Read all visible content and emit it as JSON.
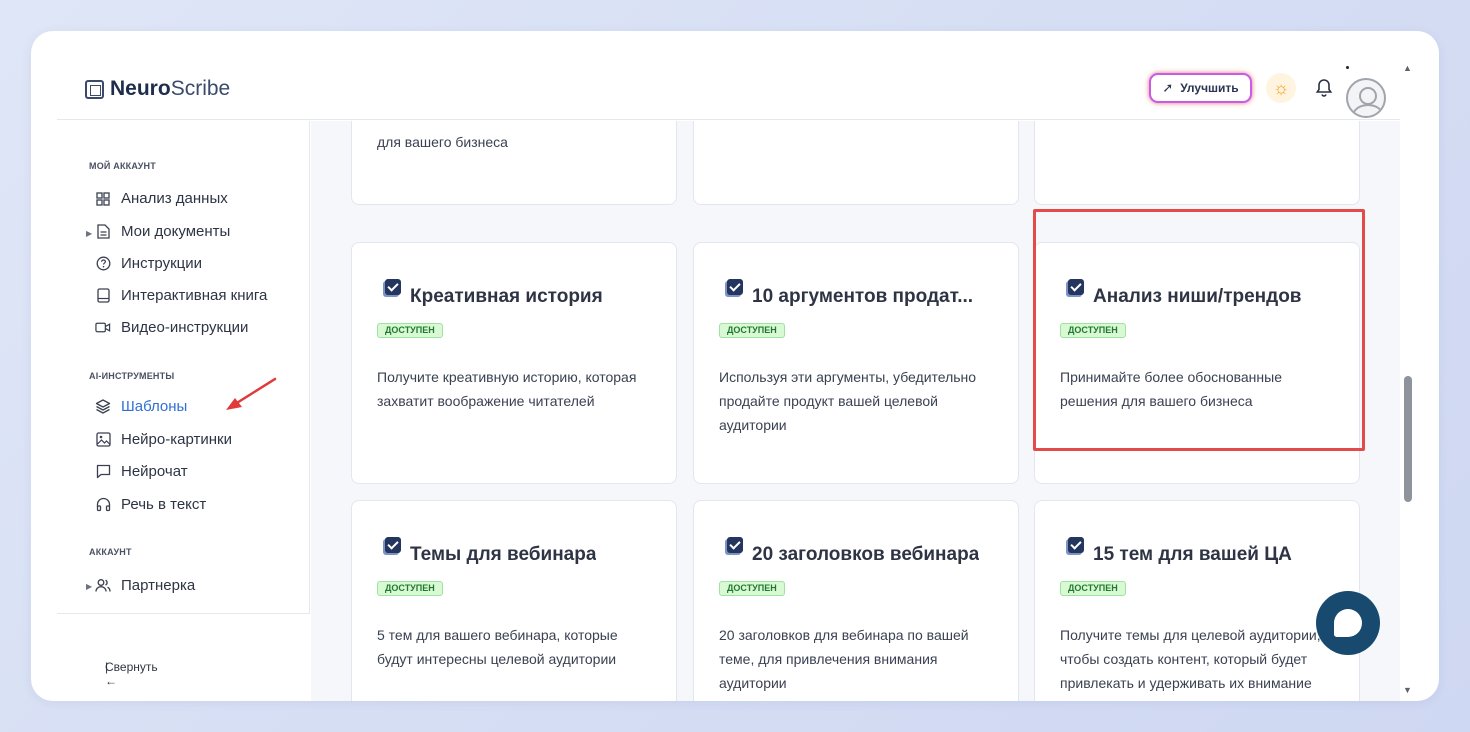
{
  "header": {
    "logo_bold": "Neuro",
    "logo_rest": "Scribe",
    "upgrade_label": "Улучшить"
  },
  "sidebar": {
    "section_account": "МОЙ АККАУНТ",
    "items_account": [
      {
        "label": "Анализ данных",
        "icon": "grid-icon"
      },
      {
        "label": "Мои документы",
        "icon": "document-icon"
      },
      {
        "label": "Инструкции",
        "icon": "help-icon"
      },
      {
        "label": "Интерактивная книга",
        "icon": "book-icon"
      },
      {
        "label": "Видео-инструкции",
        "icon": "video-icon"
      }
    ],
    "section_ai": "AI-ИНСТРУМЕНТЫ",
    "items_ai": [
      {
        "label": "Шаблоны",
        "icon": "layers-icon"
      },
      {
        "label": "Нейро-картинки",
        "icon": "image-icon"
      },
      {
        "label": "Нейрочат",
        "icon": "chat-icon"
      },
      {
        "label": "Речь в текст",
        "icon": "headphones-icon"
      }
    ],
    "section_user": "АККАУНТ",
    "items_user": [
      {
        "label": "Партнерка",
        "icon": "users-icon"
      }
    ],
    "collapse_label": "Свернуть"
  },
  "cards_top": [
    {
      "desc": "для вашего бизнеса"
    },
    {
      "desc": ""
    },
    {
      "desc": ""
    }
  ],
  "cards": [
    {
      "title": "Креативная история",
      "badge": "доступен",
      "desc": "Получите креативную историю, которая захватит воображение читателей"
    },
    {
      "title": "10 аргументов продат...",
      "badge": "доступен",
      "desc": "Используя эти аргументы, убедительно продайте продукт вашей целевой аудитории"
    },
    {
      "title": "Анализ ниши/трендов",
      "badge": "доступен",
      "desc": "Принимайте более обоснованные решения для вашего бизнеса"
    },
    {
      "title": "Темы для вебинара",
      "badge": "доступен",
      "desc": "5 тем для вашего вебинара, которые будут интересны целевой аудитории"
    },
    {
      "title": "20 заголовков вебинара",
      "badge": "доступен",
      "desc": "20 заголовков для вебинара по вашей теме, для привлечения внимания аудитории"
    },
    {
      "title": "15 тем для вашей ЦА",
      "badge": "доступен",
      "desc": "Получите темы для целевой аудитории, чтобы создать контент, который будет привлекать и удерживать их внимание"
    }
  ],
  "colors": {
    "accent_navy": "#24365e",
    "highlight_red": "#e34a4a",
    "badge_green": "#d9f8d4",
    "chat_button": "#174a6e"
  }
}
